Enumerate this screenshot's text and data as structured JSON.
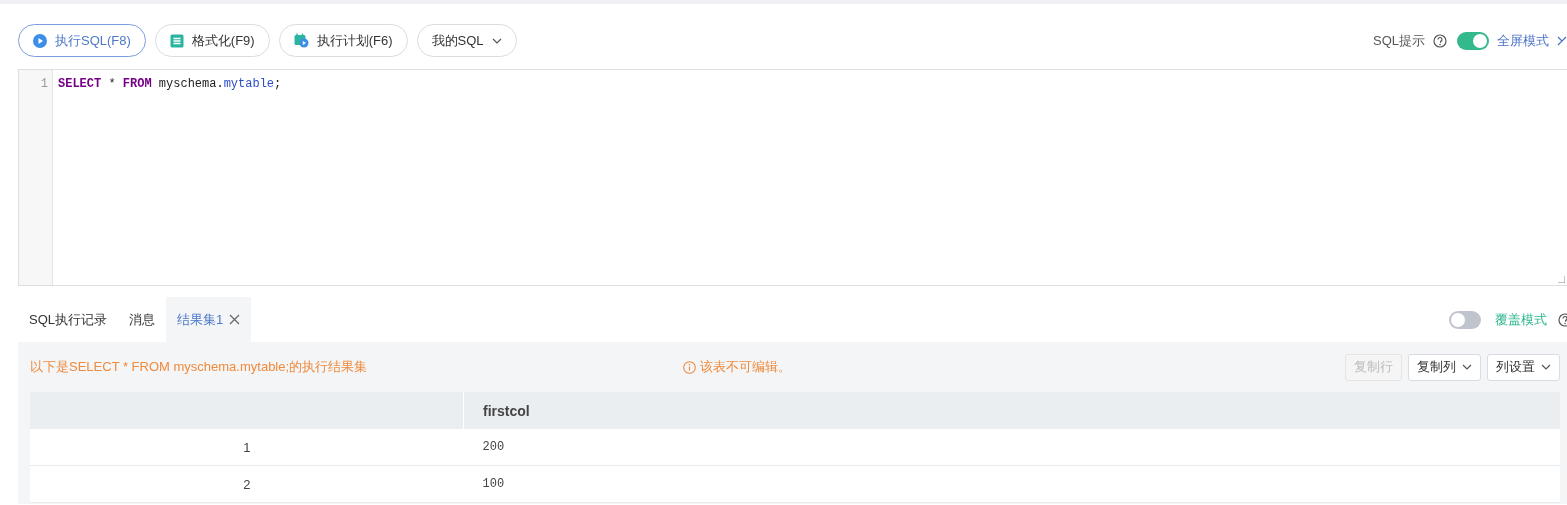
{
  "toolbar": {
    "buttons": [
      {
        "kind": "run",
        "label": "执行SQL(F8)",
        "selected": true
      },
      {
        "kind": "format",
        "label": "格式化(F9)",
        "selected": false
      },
      {
        "kind": "plan",
        "label": "执行计划(F6)",
        "selected": false
      },
      {
        "kind": "dropdown",
        "label": "我的SQL",
        "selected": false
      }
    ],
    "sql_hint": {
      "label": "SQL提示",
      "on": true
    },
    "fullscreen": {
      "label": "全屏模式"
    }
  },
  "editor": {
    "lines": [
      {
        "number": "1",
        "tokens": [
          {
            "kind": "keyword",
            "text": "SELECT"
          },
          {
            "kind": "plain",
            "text": " * "
          },
          {
            "kind": "keyword",
            "text": "FROM"
          },
          {
            "kind": "plain",
            "text": " myschema."
          },
          {
            "kind": "property",
            "text": "mytable"
          },
          {
            "kind": "plain",
            "text": ";"
          }
        ]
      }
    ]
  },
  "result_tabs": {
    "tabs": [
      {
        "label": "SQL执行记录",
        "selected": false,
        "closable": false
      },
      {
        "label": "消息",
        "selected": false,
        "closable": false
      },
      {
        "label": "结果集1",
        "selected": true,
        "closable": true
      }
    ],
    "overwrite_mode": {
      "label": "覆盖模式",
      "on": false
    }
  },
  "result": {
    "summary": "以下是SELECT * FROM myschema.mytable;的执行结果集",
    "notice": "该表不可编辑。",
    "actions": [
      {
        "label": "复制行",
        "disabled": true,
        "dropdown": false
      },
      {
        "label": "复制列",
        "disabled": false,
        "dropdown": true
      },
      {
        "label": "列设置",
        "disabled": false,
        "dropdown": true
      }
    ],
    "table": {
      "columns": [
        {
          "label": "firstcol"
        }
      ],
      "rows": [
        {
          "number": "1",
          "cells": [
            "200"
          ]
        },
        {
          "number": "2",
          "cells": [
            "100"
          ]
        }
      ]
    }
  }
}
